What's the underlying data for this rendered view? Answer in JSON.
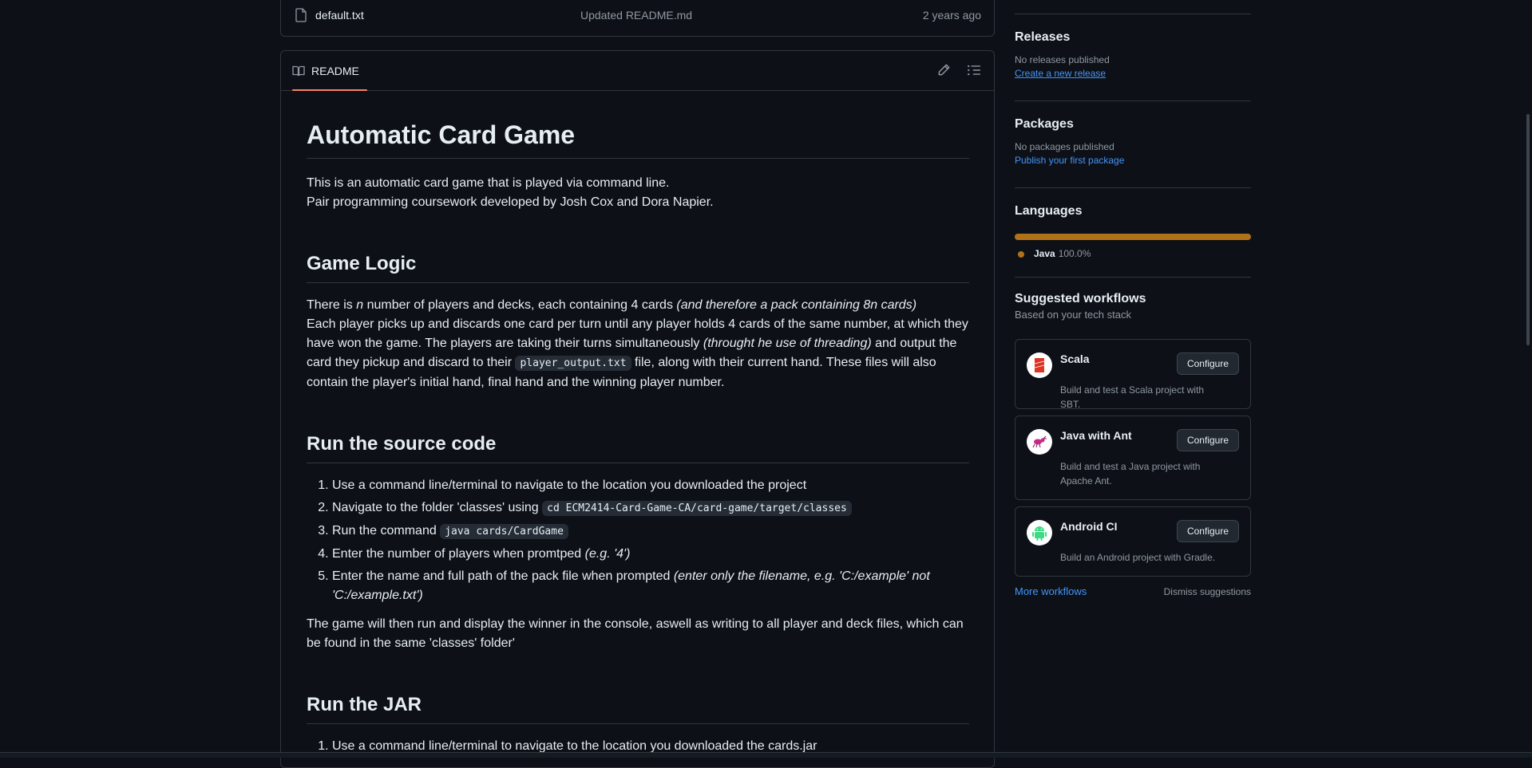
{
  "file_row": {
    "name": "default.txt",
    "commit": "Updated README.md",
    "time": "2 years ago"
  },
  "readme": {
    "tab_label": "README",
    "title": "Automatic Card Game",
    "intro_line1": "This is an automatic card game that is played via command line.",
    "intro_line2": "Pair programming coursework developed by Josh Cox and Dora Napier.",
    "h_logic": "Game Logic",
    "logic_p1_a": "There is ",
    "logic_p1_n": "n",
    "logic_p1_b": " number of players and decks, each containing 4 cards ",
    "logic_p1_em": "(and therefore a pack containing 8n cards)",
    "logic_p2_a": "Each player picks up and discards one card per turn until any player holds 4 cards of the same number, at which they have won the game. The players are taking their turns simultaneously ",
    "logic_p2_em": "(throught he use of threading)",
    "logic_p2_b": " and output the card they pickup and discard to their ",
    "logic_p2_code": "player_output.txt",
    "logic_p2_c": " file, along with their current hand. These files will also contain the player's initial hand, final hand and the winning player number.",
    "h_source": "Run the source code",
    "steps": {
      "s1": "Use a command line/terminal to navigate to the location you downloaded the project",
      "s2_text": "Navigate to the folder 'classes' using ",
      "s2_code": "cd ECM2414-Card-Game-CA/card-game/target/classes",
      "s3_text": "Run the command ",
      "s3_code": "java cards/CardGame",
      "s4_text": "Enter the number of players when promtped ",
      "s4_em": "(e.g. '4')",
      "s5_text": "Enter the name and full path of the pack file when prompted ",
      "s5_em": "(enter only the filename, e.g. 'C:/example' not 'C:/example.txt')"
    },
    "source_after": "The game will then run and display the winner in the console, aswell as writing to all player and deck files, which can be found in the same 'classes' folder'",
    "h_jar": "Run the JAR",
    "jar_step1": "Use a command line/terminal to navigate to the location you downloaded the cards.jar"
  },
  "sidebar": {
    "releases": {
      "title": "Releases",
      "empty": "No releases published",
      "link": "Create a new release"
    },
    "packages": {
      "title": "Packages",
      "empty": "No packages published",
      "link": "Publish your first package"
    },
    "languages": {
      "title": "Languages",
      "name": "Java",
      "percent": "100.0%",
      "share": 1.0,
      "color": "#b07219"
    },
    "workflows": {
      "title": "Suggested workflows",
      "subtitle": "Based on your tech stack",
      "items": [
        {
          "name": "Scala",
          "desc": "Build and test a Scala project with SBT.",
          "button": "Configure"
        },
        {
          "name": "Java with Ant",
          "desc": "Build and test a Java project with Apache Ant.",
          "button": "Configure"
        },
        {
          "name": "Android CI",
          "desc": "Build an Android project with Gradle.",
          "button": "Configure"
        }
      ],
      "more": "More workflows",
      "dismiss": "Dismiss suggestions"
    }
  },
  "colors": {
    "background": "#0d1117",
    "border": "#30363d",
    "link": "#4493f8",
    "tab_underline": "#f78166",
    "java": "#b07219"
  }
}
